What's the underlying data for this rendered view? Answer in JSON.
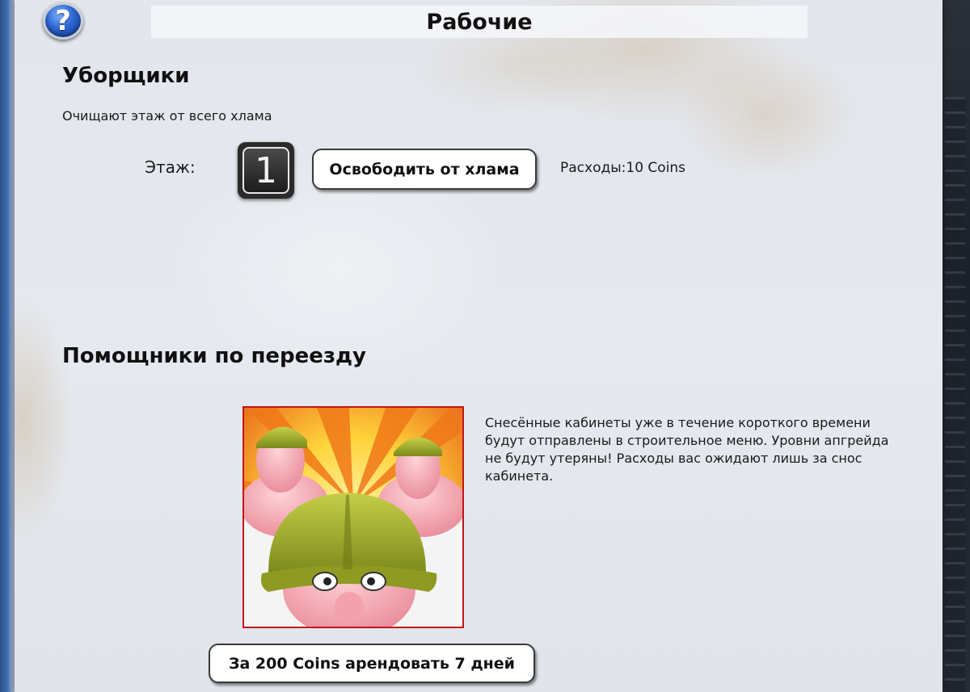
{
  "window": {
    "title": "Рабочие",
    "help_glyph": "?"
  },
  "cleaners": {
    "heading": "Уборщики",
    "description": "Очищают этаж от всего хлама",
    "floor_label": "Этаж:",
    "floor_number": "1",
    "clear_button_label": "Освободить от хлама",
    "cost_text": "Расходы:10 Coins"
  },
  "movers": {
    "heading": "Помощники по переезду",
    "portrait_icon": "movers-portrait",
    "description": "Снесённые кабинеты уже в течение короткого времени будут отправлены в строительное меню. Уровни апгрейда не будут утеряны! Расходы вас ожидают лишь за снос кабинета.",
    "rent_button_label": "За 200 Coins арендовать 7 дней"
  },
  "colors": {
    "portrait_border": "#c0161c",
    "help_blue": "#2d67d4",
    "helmet_green": "#9aa62a"
  }
}
